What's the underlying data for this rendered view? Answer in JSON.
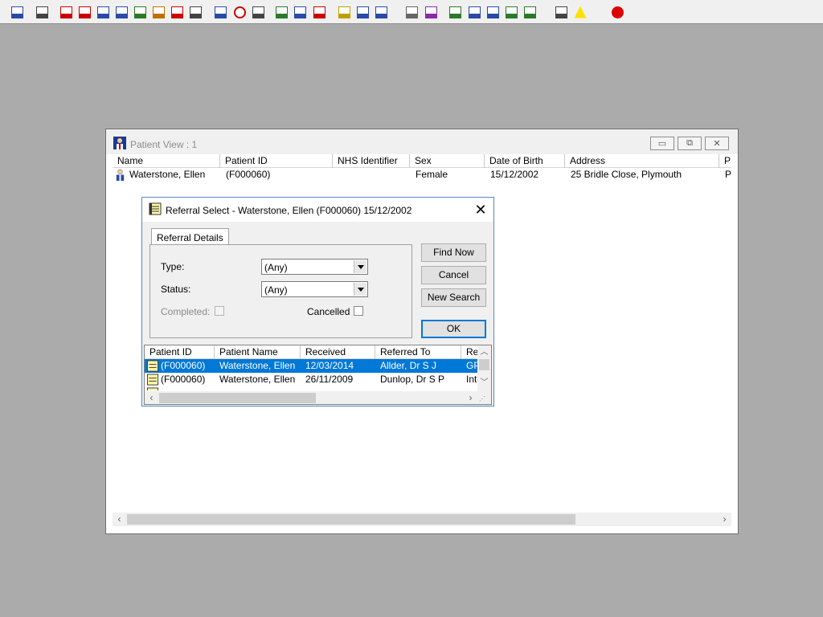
{
  "toolbar": {
    "icons": [
      "patient-search-icon",
      "printer-icon",
      "book-red-icon",
      "edit-document-icon",
      "monitor-icon",
      "m-letter-icon",
      "person-icon",
      "notepad-icon",
      "flag-icon",
      "cube-icon",
      "envelope-icon",
      "clock-icon",
      "monitor-list-icon",
      "presentation-icon",
      "chart-document-icon",
      "pie-chart-icon",
      "notes-icon",
      "bed-icon",
      "person-tasks-icon",
      "document-icon",
      "bar-chart-icon",
      "globe-icon",
      "mail-check-icon",
      "mail-document-icon",
      "mail-green-icon",
      "mail-arrow-icon",
      "transfer-icon",
      "warning-icon",
      "exit-icon"
    ]
  },
  "patient_view": {
    "title": "Patient View : 1",
    "columns": [
      "Name",
      "Patient ID",
      "NHS Identifier",
      "Sex",
      "Date of Birth",
      "Address",
      "P"
    ],
    "row": {
      "name": "Waterstone, Ellen",
      "patient_id": "(F000060)",
      "nhs_identifier": "",
      "sex": "Female",
      "dob": "15/12/2002",
      "address": "25 Bridle Close, Plymouth",
      "p": "P"
    },
    "minimize_symbol": "▭",
    "restore_symbol": "⧉",
    "close_symbol": "✕"
  },
  "referral_dialog": {
    "title": "Referral Select - Waterstone, Ellen (F000060) 15/12/2002",
    "close_symbol": "✕",
    "tab_label": "Referral Details",
    "type_label": "Type:",
    "type_value": "(Any)",
    "status_label": "Status:",
    "status_value": "(Any)",
    "completed_label": "Completed:",
    "cancelled_label": "Cancelled",
    "find_now": "Find Now",
    "cancel": "Cancel",
    "new_search": "New Search",
    "ok": "OK",
    "columns": [
      "Patient ID",
      "Patient Name",
      "Received",
      "Referred To",
      "Re"
    ],
    "rows": [
      {
        "patient_id": "(F000060)",
        "patient_name": "Waterstone, Ellen",
        "received": "12/03/2014",
        "referred_to": "Allder, Dr S J",
        "re": "GP",
        "selected": true
      },
      {
        "patient_id": "(F000060)",
        "patient_name": "Waterstone, Ellen",
        "received": "26/11/2009",
        "referred_to": "Dunlop, Dr S P",
        "re": "Inte",
        "selected": false
      }
    ]
  },
  "colors": {
    "selection": "#0078d7",
    "desktop": "#ababab",
    "default_button_border": "#0078d7"
  }
}
